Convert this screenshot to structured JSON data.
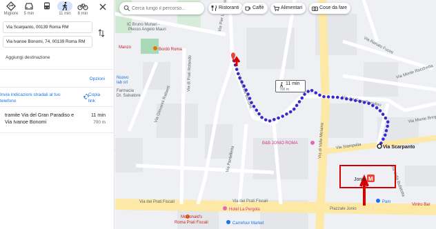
{
  "modes": [
    {
      "name": "Migliore",
      "time": "Migliore"
    },
    {
      "name": "car",
      "time": "5 min"
    },
    {
      "name": "transit",
      "time": "11 min"
    },
    {
      "name": "walk",
      "time": "11 min"
    },
    {
      "name": "bike",
      "time": "8 min"
    }
  ],
  "directions": {
    "origin": "Via Scarpanto, 00139 Roma RM",
    "destination": "Via Ivanoe Bonomi, 74, 00139 Roma RM",
    "add_destination": "Aggiungi destinazione",
    "options": "Opzioni",
    "send_line1": "Invia indicazioni stradali al tuo",
    "send_line2": "telefono",
    "copy_line1": "Copia",
    "copy_line2": "link",
    "route_line1": "tramite Via del Gran Paradiso e",
    "route_line2": "Via Ivanoe Bonomi",
    "route_time": "11 min",
    "route_distance": "700 m"
  },
  "map": {
    "search_placeholder": "Cerca lungo il percorso...",
    "chips": [
      "Ristoranti",
      "Caffè",
      "Alimentari",
      "Cose da fare"
    ],
    "route_time": "11 min",
    "route_distance": "700 m",
    "origin_label": "Via Scarpanto",
    "metro_label": "Jonio",
    "metro_letter": "M",
    "streets": {
      "s1": "Via dei Prati Fiscali",
      "s2": "Via dei Prati Fiscali",
      "s3": "Piazzale Jonio",
      "s4": "Via Stampalia",
      "s5": "Via di Valle Melaina",
      "s6": "Via Renato Fucini",
      "s7": "Via Pier Ludovico Occhini",
      "s8": "Via Ivanoe Bonomi",
      "s9": "Via di Prati Rolando",
      "s10": "Via del Gran Paradiso",
      "s11": "Via Monte Rocchetta",
      "s12": "Via Monte Bregagno",
      "s13": "Via Giovanni Raiberti",
      "s14": "Via Pantelleria",
      "s15": "Via della Bufalotta"
    },
    "pois": {
      "school": "IC Bruno Munari -",
      "school2": "Plesso Angelo Mauri",
      "bordo": "Bordò Roma",
      "manzo": "Manzo",
      "nuovo": "Nuovo",
      "lab": "lab srl",
      "farma": "Farmacia",
      "dr": "Dr. Salvatore",
      "bb": "B&B JONIO ROMA",
      "pergola": "Hotel La Pergola",
      "mc1": "McDonald's",
      "mc2": "Roma Prati Fiscali",
      "carrefour": "Carrefour Market",
      "pam": "Pam",
      "vintro": "Vintro Bar"
    }
  }
}
